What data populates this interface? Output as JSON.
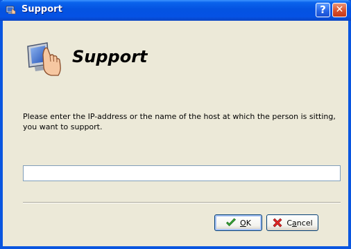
{
  "window": {
    "title": "Support",
    "help_label": "?",
    "close_label": "✕"
  },
  "header": {
    "title": "Support"
  },
  "instruction": "Please enter the IP-address or the name of the host at which the person is sitting, you want to support.",
  "host_input": {
    "value": "",
    "placeholder": ""
  },
  "buttons": {
    "ok": {
      "mnemonic": "O",
      "rest": "K"
    },
    "cancel": {
      "first": "C",
      "mnemonic": "a",
      "rest": "ncel"
    }
  },
  "icons": {
    "title": "support-monitor-hand-icon",
    "header": "support-monitor-hand-icon",
    "ok": "checkmark-icon",
    "cancel": "red-x-icon"
  },
  "colors": {
    "titlebar": "#0453e1",
    "dialog_bg": "#ece9d8",
    "close_button": "#d9512c",
    "ok_check": "#2e9a2e",
    "cancel_x": "#d42020"
  }
}
